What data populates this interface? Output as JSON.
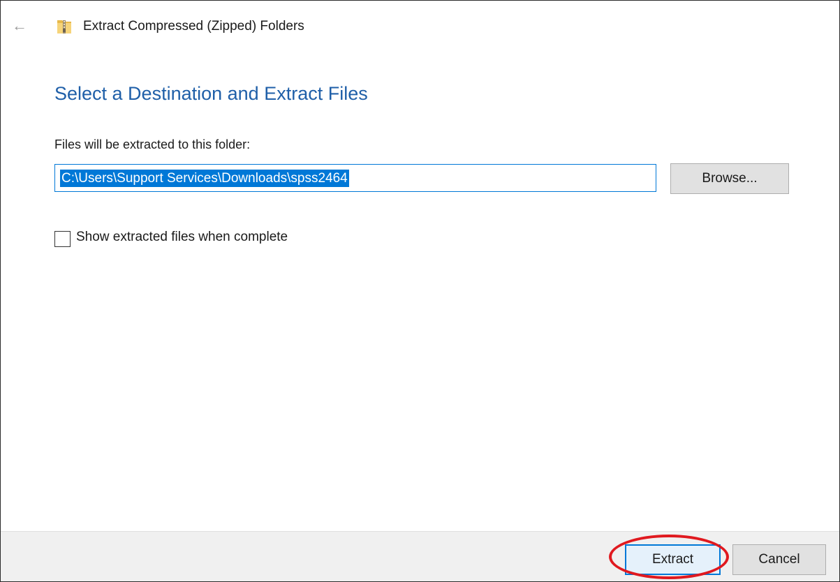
{
  "window": {
    "title": "Extract Compressed (Zipped) Folders",
    "back_icon": "back-arrow-icon",
    "app_icon": "zip-folder-icon"
  },
  "main": {
    "heading": "Select a Destination and Extract Files",
    "destination_label": "Files will be extracted to this folder:",
    "destination_path": "C:\\Users\\Support Services\\Downloads\\spss2464",
    "browse_label": "Browse...",
    "show_files_label": "Show extracted files when complete",
    "show_files_checked": false
  },
  "footer": {
    "extract_label": "Extract",
    "cancel_label": "Cancel"
  },
  "colors": {
    "heading": "#1f5fa8",
    "selection": "#0078d7",
    "annotation_ring": "#e0191f"
  }
}
